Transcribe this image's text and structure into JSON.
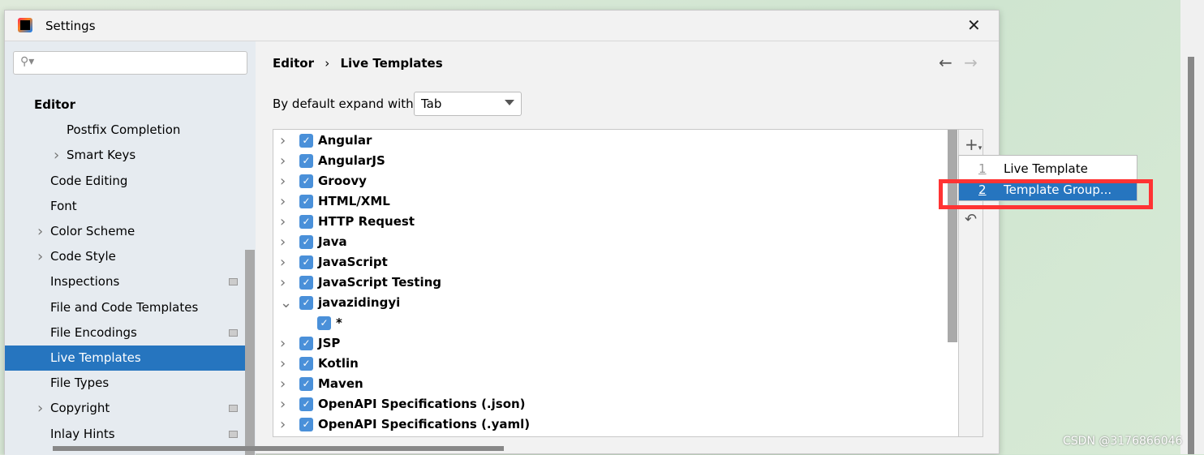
{
  "window": {
    "title": "Settings",
    "close": "✕"
  },
  "search": {
    "placeholder": "",
    "icon": "search-icon"
  },
  "sidebar": {
    "items": [
      {
        "label": "Editor",
        "level": 0,
        "bold": true
      },
      {
        "label": "Postfix Completion",
        "level": 2
      },
      {
        "label": "Smart Keys",
        "level": 2,
        "expandable": true
      },
      {
        "label": "Code Editing",
        "level": 1
      },
      {
        "label": "Font",
        "level": 1
      },
      {
        "label": "Color Scheme",
        "level": 1,
        "expandable": true
      },
      {
        "label": "Code Style",
        "level": 1,
        "expandable": true
      },
      {
        "label": "Inspections",
        "level": 1,
        "badge": true
      },
      {
        "label": "File and Code Templates",
        "level": 1
      },
      {
        "label": "File Encodings",
        "level": 1,
        "badge": true
      },
      {
        "label": "Live Templates",
        "level": 1,
        "selected": true
      },
      {
        "label": "File Types",
        "level": 1
      },
      {
        "label": "Copyright",
        "level": 1,
        "expandable": true,
        "badge": true
      },
      {
        "label": "Inlay Hints",
        "level": 1,
        "badge": true
      }
    ]
  },
  "breadcrumb": {
    "parent": "Editor",
    "sep": "›",
    "current": "Live Templates"
  },
  "expand": {
    "label": "By default expand with",
    "value": "Tab"
  },
  "templates": [
    {
      "label": "Angular",
      "checked": true,
      "expanded": false
    },
    {
      "label": "AngularJS",
      "checked": true,
      "expanded": false
    },
    {
      "label": "Groovy",
      "checked": true,
      "expanded": false
    },
    {
      "label": "HTML/XML",
      "checked": true,
      "expanded": false
    },
    {
      "label": "HTTP Request",
      "checked": true,
      "expanded": false
    },
    {
      "label": "Java",
      "checked": true,
      "expanded": false
    },
    {
      "label": "JavaScript",
      "checked": true,
      "expanded": false
    },
    {
      "label": "JavaScript Testing",
      "checked": true,
      "expanded": false
    },
    {
      "label": "javazidingyi",
      "checked": true,
      "expanded": true
    },
    {
      "label": "*",
      "checked": true,
      "child": true
    },
    {
      "label": "JSP",
      "checked": true,
      "expanded": false
    },
    {
      "label": "Kotlin",
      "checked": true,
      "expanded": false
    },
    {
      "label": "Maven",
      "checked": true,
      "expanded": false
    },
    {
      "label": "OpenAPI Specifications (.json)",
      "checked": true,
      "expanded": false
    },
    {
      "label": "OpenAPI Specifications (.yaml)",
      "checked": true,
      "expanded": false
    }
  ],
  "popup": {
    "items": [
      {
        "mnemonic": "1",
        "label": "Live Template"
      },
      {
        "mnemonic": "2",
        "label": "Template Group...",
        "selected": true
      }
    ]
  },
  "colors": {
    "selection": "#2675bf",
    "highlight": "#ff3333",
    "checkbox": "#4a90d9"
  },
  "watermark": "CSDN @3176866046"
}
